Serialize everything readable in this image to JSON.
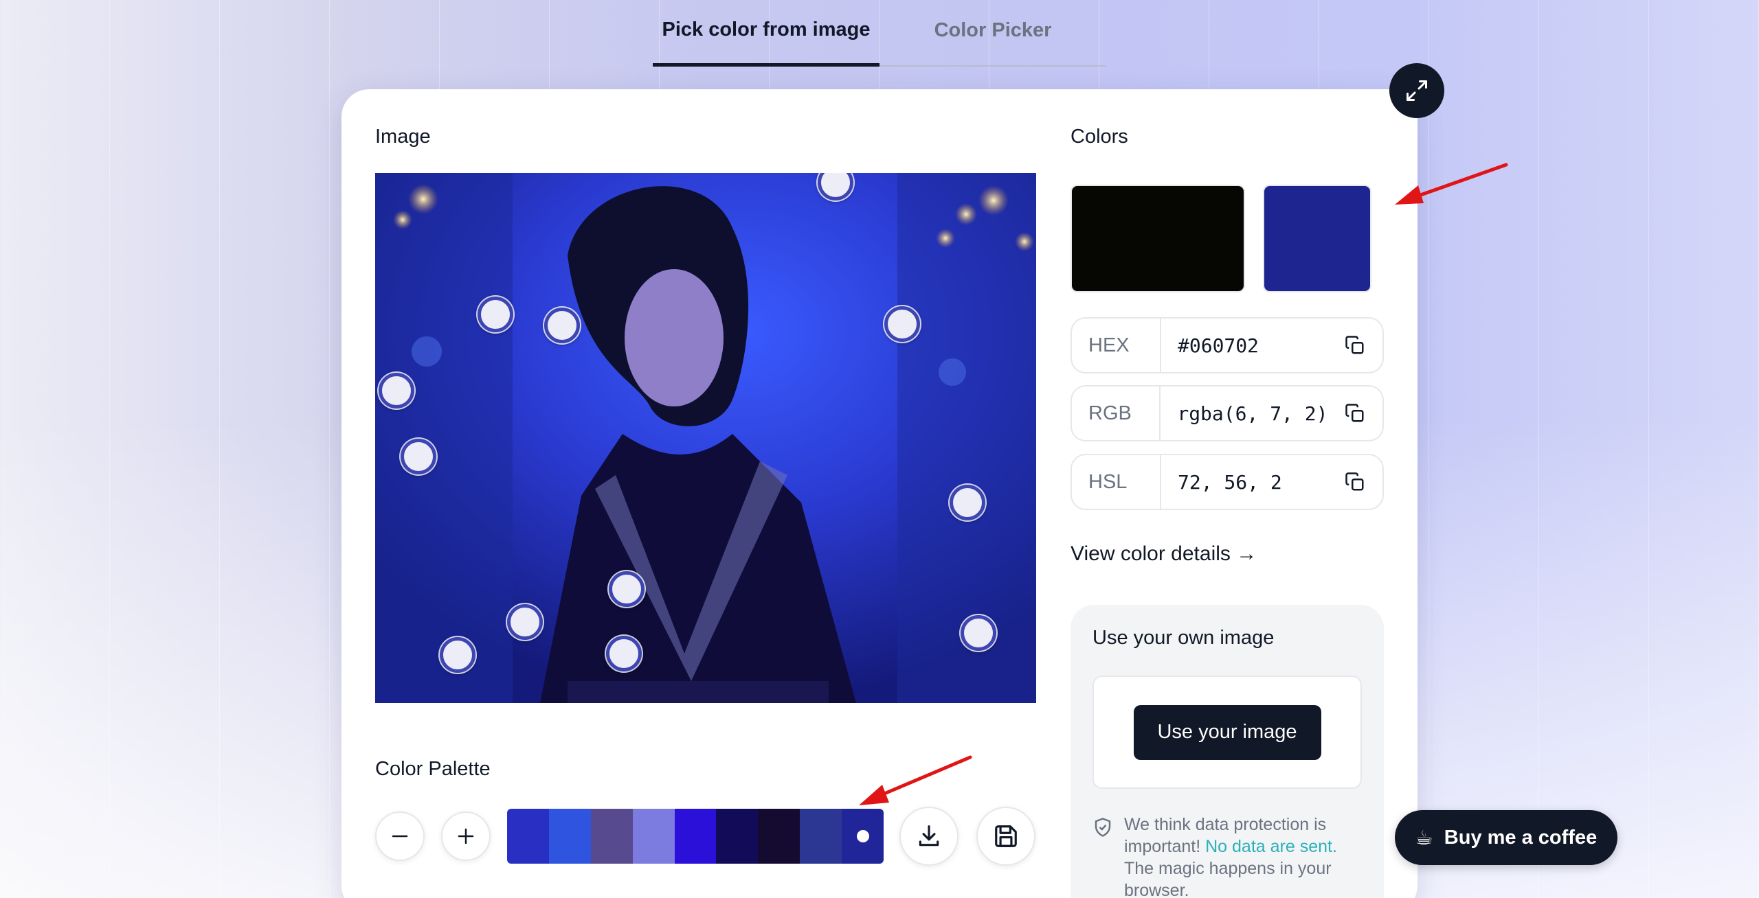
{
  "tabs": [
    {
      "label": "Pick color from image",
      "active": true
    },
    {
      "label": "Color Picker",
      "active": false
    }
  ],
  "image_section": {
    "title": "Image"
  },
  "colors_section": {
    "title": "Colors",
    "swatches": [
      {
        "name": "selected",
        "color": "#060702"
      },
      {
        "name": "hovered",
        "color": "#1e2490"
      }
    ],
    "hex": {
      "label": "HEX",
      "value": "#060702"
    },
    "rgb": {
      "label": "RGB",
      "value": "rgba(6, 7, 2)"
    },
    "hsl": {
      "label": "HSL",
      "value": "72, 56, 2"
    },
    "details_link": "View color details →"
  },
  "own_image": {
    "title": "Use your own image",
    "button": "Use your image",
    "privacy_pre": "We think data protection is important! ",
    "privacy_highlight": "No data are sent.",
    "privacy_post": " The magic happens in your browser."
  },
  "palette": {
    "title": "Color Palette",
    "colors": [
      "#2a2fc4",
      "#2f55e0",
      "#584a8f",
      "#7b7be0",
      "#2a10d9",
      "#120b58",
      "#150a2f",
      "#2c3793",
      "#20269a"
    ],
    "selected_index": 8
  },
  "coffee": {
    "icon": "coffee-icon",
    "glyph": "☕",
    "label": "Buy me a coffee"
  },
  "icons": {
    "expand": "expand-icon",
    "copy": "copy-icon",
    "minus": "minus-icon",
    "plus": "plus-icon",
    "download": "download-icon",
    "save": "save-icon",
    "shield": "shield-check-icon"
  }
}
